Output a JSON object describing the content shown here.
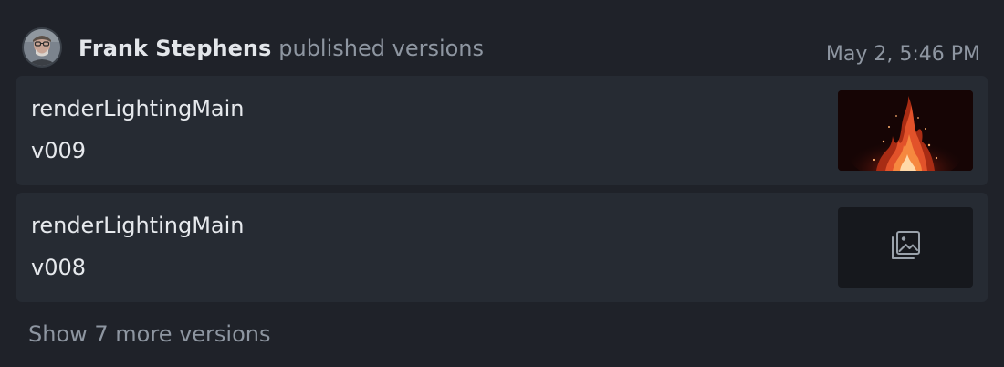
{
  "activity": {
    "user_name": "Frank Stephens",
    "action": "published versions",
    "timestamp": "May 2, 5:46 PM"
  },
  "versions": [
    {
      "name": "renderLightingMain",
      "version": "v009",
      "thumbnail": "fire-render-thumbnail"
    },
    {
      "name": "renderLightingMain",
      "version": "v008",
      "thumbnail": "image-placeholder-icon"
    }
  ],
  "show_more_label": "Show 7 more versions",
  "colors": {
    "background": "#1f2229",
    "card": "#262b33",
    "text_primary": "#e6e9ed",
    "text_muted": "#8e96a1"
  }
}
